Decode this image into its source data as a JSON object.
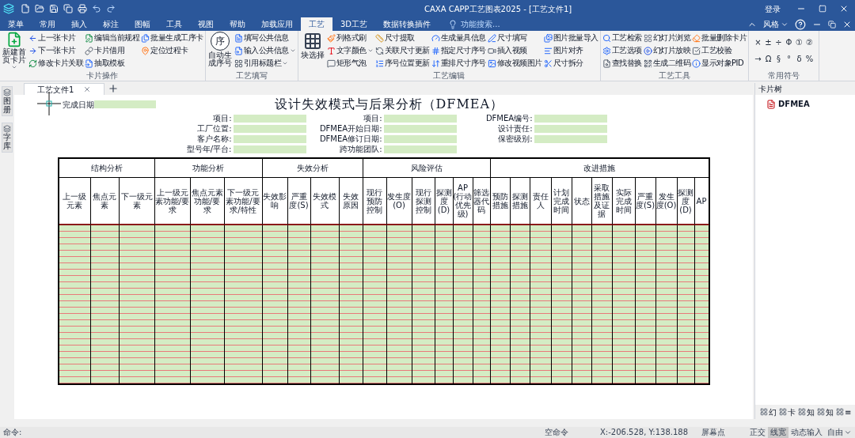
{
  "title_bar": {
    "title": "CAXA CAPP工艺图表2025 - [工艺文件1]",
    "login": "登录"
  },
  "menu_tabs": [
    {
      "label": "菜单",
      "selected": false
    },
    {
      "label": "常用",
      "selected": false
    },
    {
      "label": "插入",
      "selected": false
    },
    {
      "label": "标注",
      "selected": false
    },
    {
      "label": "图幅",
      "selected": false
    },
    {
      "label": "工具",
      "selected": false
    },
    {
      "label": "视图",
      "selected": false
    },
    {
      "label": "帮助",
      "selected": false
    },
    {
      "label": "加载应用",
      "selected": false
    },
    {
      "label": "工艺",
      "selected": true
    },
    {
      "label": "3D工艺",
      "selected": false
    },
    {
      "label": "数据转换插件",
      "selected": false
    }
  ],
  "search": {
    "placeholder": "功能搜索..."
  },
  "style_menu": {
    "label": "风格"
  },
  "ribbon_groups": [
    {
      "label": "卡片操作",
      "large": {
        "label": "新建首页卡片",
        "dropdown": true
      },
      "columns": [
        [
          {
            "label": "上一张卡片"
          },
          {
            "label": "下一张卡片"
          },
          {
            "label": "修改卡片关联"
          }
        ],
        [
          {
            "label": "编辑当前规程"
          },
          {
            "label": "卡片借用"
          },
          {
            "label": "抽取模板"
          }
        ],
        [
          {
            "label": "批量生成工序卡"
          },
          {
            "label": "定位过程卡"
          }
        ]
      ]
    },
    {
      "label": "工艺填写",
      "large": {
        "label": "自动生成序号",
        "glyph": "序"
      },
      "columns": [
        [
          {
            "label": "填写公共信息"
          },
          {
            "label": "输入公共信息",
            "dropdown": true
          },
          {
            "label": "引用标题栏",
            "dropdown": true
          }
        ]
      ]
    },
    {
      "label": "工艺编辑",
      "large": {
        "label": "块选择"
      },
      "columns": [
        [
          {
            "label": "列格式刷"
          },
          {
            "label": "文字颜色",
            "dropdown": true
          },
          {
            "label": "矩形气泡"
          }
        ],
        [
          {
            "label": "尺寸提取"
          },
          {
            "label": "关联尺寸更新"
          },
          {
            "label": "序号位置更新"
          }
        ],
        [
          {
            "label": "生成量具信息"
          },
          {
            "label": "指定尺寸序号"
          },
          {
            "label": "重排尺寸序号"
          }
        ],
        [
          {
            "label": "尺寸填写"
          },
          {
            "label": "插入视频"
          },
          {
            "label": "修改视频图片"
          }
        ],
        [
          {
            "label": "图片批量导入"
          },
          {
            "label": "图片对齐"
          },
          {
            "label": "尺寸拆分"
          }
        ]
      ]
    },
    {
      "label": "工艺工具",
      "columns": [
        [
          {
            "label": "工艺检索"
          },
          {
            "label": "工艺选项"
          },
          {
            "label": "查找替换"
          }
        ],
        [
          {
            "label": "幻灯片浏览"
          },
          {
            "label": "幻灯片放映"
          },
          {
            "label": "生成二维码"
          }
        ],
        [
          {
            "label": "批量删除卡片"
          },
          {
            "label": "工艺校验"
          },
          {
            "label": "显示对象PID"
          }
        ]
      ]
    },
    {
      "label": "常用符号",
      "symbols": [
        [
          "×",
          "±",
          "÷",
          "Φ",
          "①",
          "②"
        ],
        [
          "→",
          "Ω",
          "§",
          "°",
          "δ",
          "%"
        ]
      ]
    }
  ],
  "left_panel_tabs": [
    {
      "label": "图册"
    },
    {
      "label": "字库"
    }
  ],
  "doc_tabs": [
    {
      "label": "工艺文件1"
    }
  ],
  "form": {
    "title": "设计失效模式与后果分析（DFMEA）",
    "completion_date_label": "完成日期",
    "header_fields": [
      [
        {
          "label": "项目:"
        },
        {
          "label": "工厂位置:"
        },
        {
          "label": "客户名称:"
        },
        {
          "label": "型号年/平台:"
        }
      ],
      [
        {
          "label": "项目:"
        },
        {
          "label": "DFMEA开始日期:"
        },
        {
          "label": "DFMEA修订日期:"
        },
        {
          "label": "跨功能团队:"
        }
      ],
      [
        {
          "label": "DFMEA编号:"
        },
        {
          "label": "设计责任:"
        },
        {
          "label": "保密级别:"
        }
      ]
    ],
    "table": {
      "groups": [
        {
          "label": "结构分析",
          "columns": [
            "上一级元素",
            "焦点元素",
            "下一级元素"
          ]
        },
        {
          "label": "功能分析",
          "columns": [
            "上一级元素功能/要求",
            "焦点元素功能/要求",
            "下一级元素功能/要求/特性"
          ]
        },
        {
          "label": "失效分析",
          "columns": [
            "失效影响",
            "严重度(S)",
            "失效模式",
            "失效原因"
          ]
        },
        {
          "label": "风险评估",
          "columns": [
            "现行预防控制",
            "发生度(O)",
            "现行探测控制",
            "探测度(D)",
            "AP(行动优先级)",
            "筛选器代码"
          ]
        },
        {
          "label": "改进措施",
          "columns": [
            "预防措施",
            "探测措施",
            "责任人",
            "计划完成时间",
            "状态",
            "采取措施及证据",
            "实际完成时间",
            "严重度(S)",
            "发生度(O)",
            "探测度(D)",
            "AP"
          ]
        }
      ]
    }
  },
  "right_panel": {
    "title": "卡片树",
    "tree": [
      {
        "label": "DFMEA"
      }
    ],
    "bottom_tabs": [
      {
        "label": "幻"
      },
      {
        "label": "卡"
      },
      {
        "label": "知"
      },
      {
        "label": "知"
      },
      {
        "label": "≡"
      }
    ]
  },
  "status_bar": {
    "prompt": "命令:",
    "command": "空命令",
    "coordinates": "X:-206.528, Y:138.188",
    "snap": "屏幕点",
    "toggles": [
      {
        "label": "正交",
        "on": false
      },
      {
        "label": "线宽",
        "on": true
      },
      {
        "label": "动态输入",
        "on": false
      }
    ],
    "mode": "自由"
  }
}
